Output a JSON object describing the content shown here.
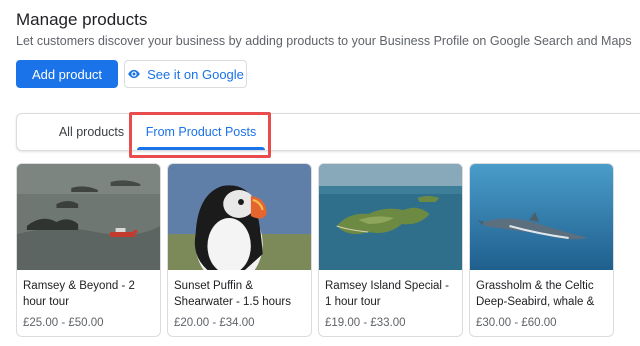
{
  "header": {
    "title": "Manage products",
    "subtitle": "Let customers discover your business by adding products to your Business Profile on Google Search and Maps"
  },
  "actions": {
    "add_product": "Add product",
    "see_on_google": "See it on Google"
  },
  "tabs": [
    {
      "label": "All products",
      "selected": false
    },
    {
      "label": "From Product Posts",
      "selected": true
    }
  ],
  "products": [
    {
      "title": "Ramsey & Beyond - 2 hour tour",
      "price": "£25.00 - £50.00"
    },
    {
      "title": "Sunset Puffin & Shearwater - 1.5 hours",
      "price": "£20.00 - £34.00"
    },
    {
      "title": "Ramsey Island Special - 1 hour tour",
      "price": "£19.00 - £33.00"
    },
    {
      "title": "Grassholm & the Celtic Deep-Seabird, whale & D…",
      "price": "£30.00 - £60.00"
    }
  ],
  "colors": {
    "accent": "#1a73e8",
    "highlight_border": "#e94c4c"
  }
}
